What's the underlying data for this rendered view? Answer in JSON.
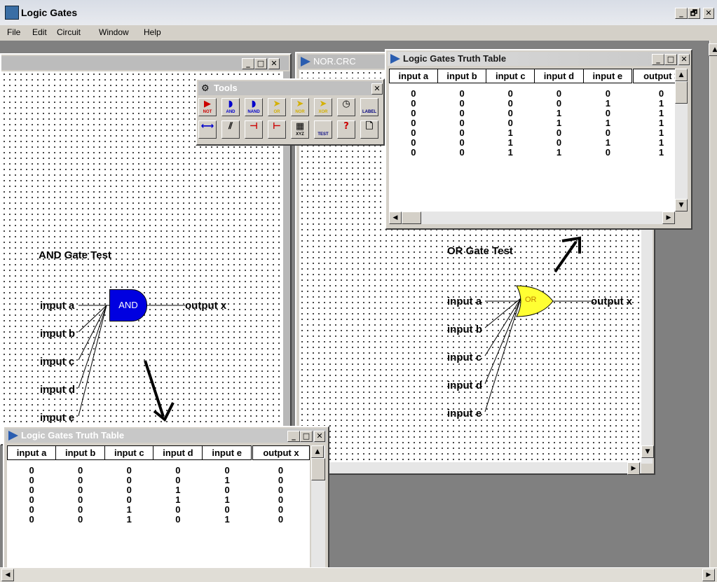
{
  "app": {
    "title": "Logic Gates"
  },
  "window_controls": {
    "minimize": "_",
    "restore": "🗗",
    "close": "✕"
  },
  "menu": [
    "File",
    "Edit",
    "Circuit",
    "Window",
    "Help"
  ],
  "tools": {
    "title": "Tools",
    "row1": [
      {
        "icon": "not-gate-icon",
        "label": "NOT",
        "glyph": "▶",
        "color": "#cc0000"
      },
      {
        "icon": "and-gate-icon",
        "label": "AND",
        "glyph": "◗",
        "color": "#0000cc"
      },
      {
        "icon": "nand-gate-icon",
        "label": "NAND",
        "glyph": "◗",
        "color": "#0000cc"
      },
      {
        "icon": "or-gate-icon",
        "label": "OR",
        "glyph": "➤",
        "color": "#d4b000"
      },
      {
        "icon": "nor-gate-icon",
        "label": "NOR",
        "glyph": "➤",
        "color": "#d4b000"
      },
      {
        "icon": "xor-gate-icon",
        "label": "XOR",
        "glyph": "➤",
        "color": "#d4b000"
      },
      {
        "icon": "clock-icon",
        "label": "",
        "glyph": "◷",
        "color": "#000000"
      },
      {
        "icon": "label-tool-icon",
        "label": "LABEL",
        "glyph": "",
        "color": "#000080"
      }
    ],
    "row2": [
      {
        "icon": "wire-icon",
        "label": "",
        "glyph": "⟷",
        "color": "#0000cc"
      },
      {
        "icon": "cut-wire-icon",
        "label": "",
        "glyph": "⫽",
        "color": "#000000"
      },
      {
        "icon": "input-junction-icon",
        "label": "",
        "glyph": "⊣",
        "color": "#cc0000"
      },
      {
        "icon": "output-junction-icon",
        "label": "",
        "glyph": "⊢",
        "color": "#cc0000"
      },
      {
        "icon": "truth-table-icon",
        "label": "XYZ",
        "glyph": "▦",
        "color": "#000000"
      },
      {
        "icon": "test-icon",
        "label": "TEST",
        "glyph": "",
        "color": "#000080"
      },
      {
        "icon": "help-icon",
        "label": "",
        "glyph": "?",
        "color": "#cc0000"
      },
      {
        "icon": "new-page-icon",
        "label": "",
        "glyph": "🗋",
        "color": "#000000"
      }
    ]
  },
  "nor_window": {
    "title": "NOR.CRC"
  },
  "and_circuit": {
    "title": "AND Gate Test",
    "gate": "AND",
    "inputs": [
      "input a",
      "input b",
      "input c",
      "input d",
      "input e"
    ],
    "output": "output x"
  },
  "or_circuit": {
    "title": "OR Gate Test",
    "gate": "OR",
    "inputs": [
      "input a",
      "input b",
      "input c",
      "input d",
      "input e"
    ],
    "output": "output x"
  },
  "truth_table_top": {
    "title": "Logic Gates Truth Table",
    "headers": [
      "input a",
      "input b",
      "input c",
      "input d",
      "input e",
      "output x"
    ],
    "header_visible": [
      "input a",
      "input b",
      "input c",
      "input d",
      "input e",
      "output >"
    ],
    "rows": [
      [
        "0",
        "0",
        "0",
        "0",
        "0",
        "0"
      ],
      [
        "0",
        "0",
        "0",
        "0",
        "1",
        "1"
      ],
      [
        "0",
        "0",
        "0",
        "1",
        "0",
        "1"
      ],
      [
        "0",
        "0",
        "0",
        "1",
        "1",
        "1"
      ],
      [
        "0",
        "0",
        "1",
        "0",
        "0",
        "1"
      ],
      [
        "0",
        "0",
        "1",
        "0",
        "1",
        "1"
      ],
      [
        "0",
        "0",
        "1",
        "1",
        "0",
        "1"
      ]
    ]
  },
  "truth_table_bottom": {
    "title": "Logic Gates Truth Table",
    "headers": [
      "input a",
      "input b",
      "input c",
      "input d",
      "input e",
      "output x"
    ],
    "rows": [
      [
        "0",
        "0",
        "0",
        "0",
        "0",
        "0"
      ],
      [
        "0",
        "0",
        "0",
        "0",
        "1",
        "0"
      ],
      [
        "0",
        "0",
        "0",
        "1",
        "0",
        "0"
      ],
      [
        "0",
        "0",
        "0",
        "1",
        "1",
        "0"
      ],
      [
        "0",
        "0",
        "1",
        "0",
        "0",
        "0"
      ],
      [
        "0",
        "0",
        "1",
        "0",
        "1",
        "0"
      ]
    ]
  },
  "colors": {
    "and_gate": "#0000e0",
    "or_gate": "#ffff33",
    "canvas_dot": "#222222"
  }
}
